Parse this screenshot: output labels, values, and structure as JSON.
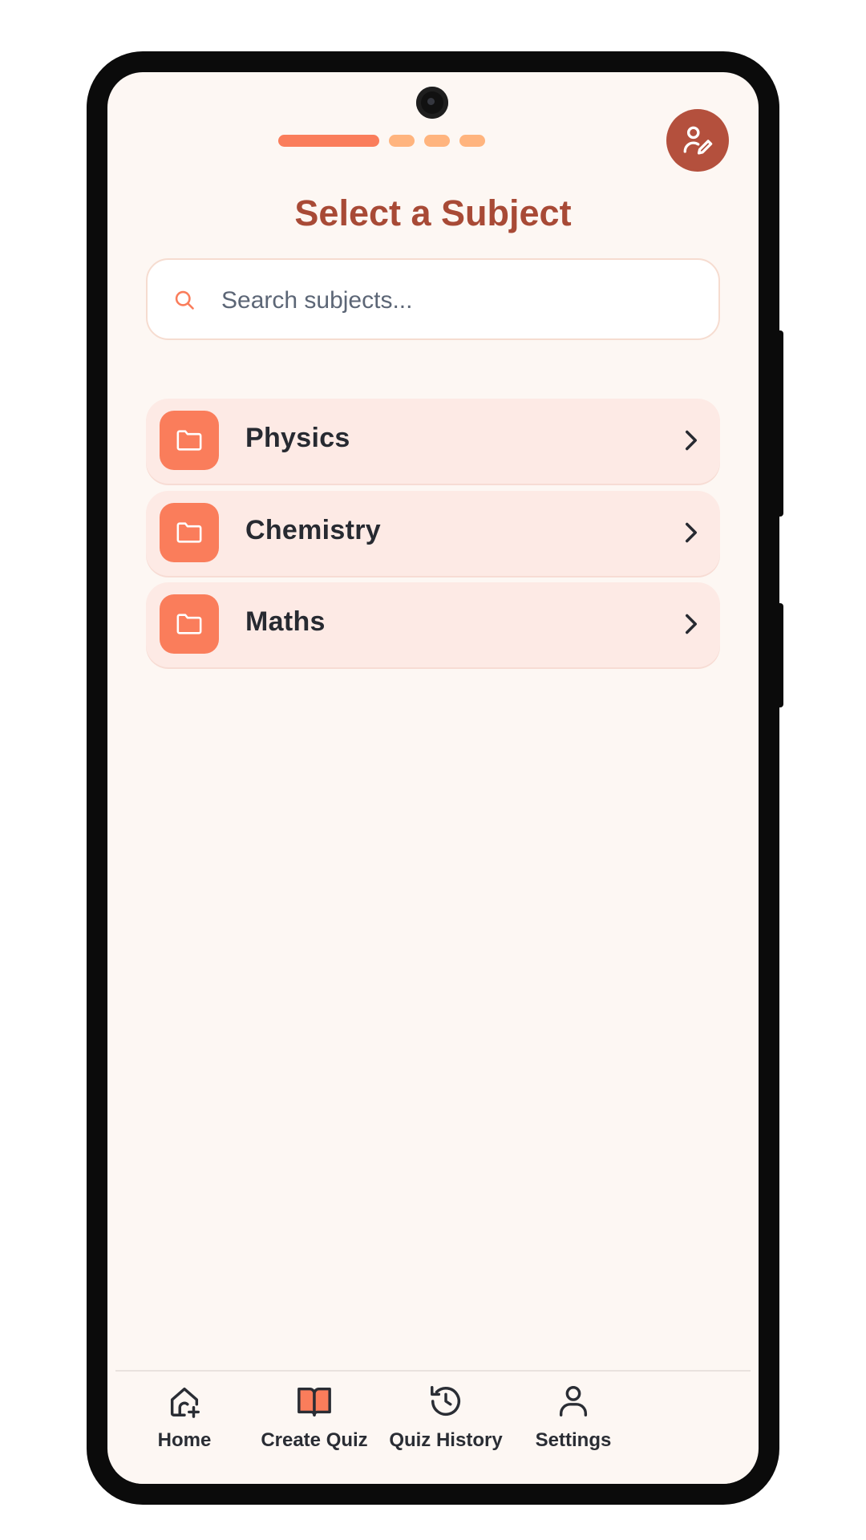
{
  "header": {
    "title": "Select a Subject",
    "progress_steps": {
      "total": 4,
      "current": 1
    },
    "avatar_icon": "user-edit-icon"
  },
  "search": {
    "placeholder": "Search subjects...",
    "value": "",
    "icon": "search-icon"
  },
  "subjects": [
    {
      "label": "Physics",
      "icon": "folder-icon"
    },
    {
      "label": "Chemistry",
      "icon": "folder-icon"
    },
    {
      "label": "Maths",
      "icon": "folder-icon"
    }
  ],
  "nav": [
    {
      "label": "Home",
      "icon": "home-add-icon",
      "active": false
    },
    {
      "label": "Create Quiz",
      "icon": "book-open-icon",
      "active": true
    },
    {
      "label": "Quiz History",
      "icon": "history-icon",
      "active": false
    },
    {
      "label": "Settings",
      "icon": "user-icon",
      "active": false
    }
  ],
  "colors": {
    "accent": "#fa7d5b",
    "accent_light": "#ffb47e",
    "title": "#a84a36",
    "avatar_bg": "#b4503d",
    "card_bg": "#fdeae5",
    "screen_bg": "#fdf7f3"
  }
}
